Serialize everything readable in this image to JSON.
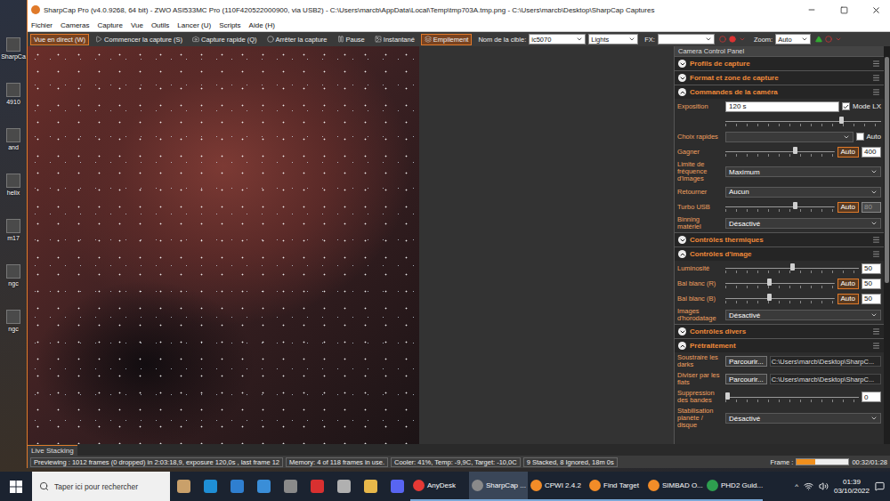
{
  "desktop": {
    "icons": [
      {
        "label": "SharpCa"
      },
      {
        "label": "4910"
      },
      {
        "label": "and"
      },
      {
        "label": "helix"
      },
      {
        "label": "m17"
      },
      {
        "label": "ngc"
      },
      {
        "label": "ngc"
      }
    ]
  },
  "window": {
    "title": "SharpCap Pro (v4.0.9268, 64 bit) - ZWO ASI533MC Pro (110F420522000900, via USB2) - C:\\Users\\marcb\\AppData\\Local\\Temp\\tmp703A.tmp.png - C:\\Users\\marcb\\Desktop\\SharpCap Captures"
  },
  "menu": [
    "Fichier",
    "Cameras",
    "Capture",
    "Vue",
    "Outils",
    "Lancer (U)",
    "Scripts",
    "Aide (H)"
  ],
  "toolbar": {
    "buttons": [
      {
        "label": "Vue en direct (W)",
        "selected": true
      },
      {
        "label": "Commencer la capture (S)",
        "selected": false
      },
      {
        "label": "Capture rapide (Q)",
        "selected": false
      },
      {
        "label": "Arrêter la capture",
        "selected": false
      },
      {
        "label": "Pause",
        "selected": false
      },
      {
        "label": "Instantané",
        "selected": false
      },
      {
        "label": "Empilement",
        "selected": true
      }
    ],
    "target_label": "Nom de la cible:",
    "target": "ic5070",
    "frame_type": "Lights",
    "fx_label": "FX:",
    "fx": "",
    "zoom_label": "Zoom:",
    "zoom": "Auto"
  },
  "panel": {
    "title": "Camera Control Panel",
    "sections": [
      {
        "title": "Profils de capture",
        "expanded": false,
        "rows": []
      },
      {
        "title": "Format et zone de capture",
        "expanded": false,
        "rows": []
      },
      {
        "title": "Commandes de la caméra",
        "expanded": true,
        "rows": [
          {
            "kind": "field",
            "label": "Exposition",
            "value": "120 s",
            "check": {
              "label": "Mode LX",
              "checked": true
            }
          },
          {
            "kind": "slider",
            "label": "",
            "level": 0.75,
            "disabled": false
          },
          {
            "kind": "select",
            "label": "Choix rapides",
            "value": "",
            "check": {
              "label": "Auto",
              "checked": false
            }
          },
          {
            "kind": "slider",
            "label": "Gagner",
            "level": 0.65,
            "auto": "Auto",
            "value": "400",
            "disabled": false
          },
          {
            "kind": "select",
            "label": "Limite de fréquence d'images",
            "value": "Maximum"
          },
          {
            "kind": "select",
            "label": "Retourner",
            "value": "Aucun"
          },
          {
            "kind": "slider",
            "label": "Turbo USB",
            "level": 0.65,
            "auto": "Auto",
            "value": "80",
            "disabled": true
          },
          {
            "kind": "select",
            "label": "Binning matériel",
            "value": "Désactivé"
          }
        ]
      },
      {
        "title": "Contrôles thermiques",
        "expanded": false,
        "rows": []
      },
      {
        "title": "Contrôles d'image",
        "expanded": true,
        "rows": [
          {
            "kind": "slider",
            "label": "Luminosité",
            "level": 0.5,
            "value": "50",
            "disabled": false
          },
          {
            "kind": "slider",
            "label": "Bal blanc (R)",
            "level": 0.4,
            "auto": "Auto",
            "value": "50",
            "disabled": false
          },
          {
            "kind": "slider",
            "label": "Bal blanc (B)",
            "level": 0.4,
            "auto": "Auto",
            "value": "50",
            "disabled": false
          },
          {
            "kind": "select",
            "label": "Images d'horodatage",
            "value": "Désactivé"
          }
        ]
      },
      {
        "title": "Contrôles divers",
        "expanded": false,
        "rows": []
      },
      {
        "title": "Prétraitement",
        "expanded": true,
        "rows": [
          {
            "kind": "file",
            "label": "Soustraire les darks",
            "button": "Parcourir...",
            "path": "C:\\Users\\marcb\\Desktop\\SharpC..."
          },
          {
            "kind": "file",
            "label": "Diviser par les flats",
            "button": "Parcourir...",
            "path": "C:\\Users\\marcb\\Desktop\\SharpC..."
          },
          {
            "kind": "slider",
            "label": "Suppression des bandes",
            "level": 0,
            "value": "0",
            "disabled": false
          },
          {
            "kind": "select",
            "label": "Stabilisation planète / disque",
            "value": "Désactivé"
          }
        ]
      }
    ]
  },
  "live_stacking_tab": "Live Stacking",
  "status_bar": {
    "previewing": "Previewing : 1012 frames (0 dropped) in 2:03:18,9, exposure 120,0s , last frame 12",
    "memory": "Memory: 4 of 118 frames in use.",
    "cooler": "Cooler: 41%, Temp: -9,9C, Target: -10,0C",
    "stacking": "9 Stacked, 8 Ignored, 18m 0s",
    "frame_label": "Frame :",
    "frame_level": 0.36,
    "time": "00:32/01:28"
  },
  "taskbar": {
    "search_placeholder": "Taper ici pour rechercher",
    "pinned": [
      {
        "color": "#c9a06a"
      },
      {
        "color": "#1f8fd6"
      },
      {
        "color": "#2f7fd0"
      },
      {
        "color": "#3a8ed8"
      },
      {
        "color": "#8a8a8a"
      },
      {
        "color": "#d93030"
      },
      {
        "color": "#b0b0b0"
      },
      {
        "color": "#e8b84a"
      },
      {
        "color": "#5865f2"
      }
    ],
    "apps": [
      {
        "label": "AnyDesk",
        "selected": false,
        "color": "#e53935"
      },
      {
        "label": "SharpCap ...",
        "selected": true,
        "color": "#8a8a8a"
      },
      {
        "label": "CPWI 2.4.2",
        "selected": false,
        "color": "#f28c28"
      },
      {
        "label": "Find Target",
        "selected": false,
        "color": "#f28c28"
      },
      {
        "label": "SIMBAD O...",
        "selected": false,
        "color": "#f28c28"
      },
      {
        "label": "PHD2 Guid...",
        "selected": false,
        "color": "#2e9e4f"
      }
    ],
    "tray": {
      "chevron": "^",
      "time": "01:39",
      "date": "03/10/2022"
    }
  }
}
